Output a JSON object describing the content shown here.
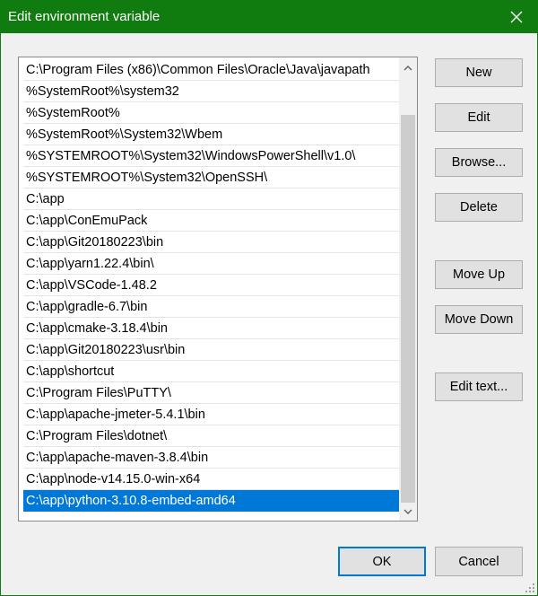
{
  "window": {
    "title": "Edit environment variable"
  },
  "path_list": {
    "selected_index": 20,
    "items": [
      "C:\\Program Files (x86)\\Common Files\\Oracle\\Java\\javapath",
      "%SystemRoot%\\system32",
      "%SystemRoot%",
      "%SystemRoot%\\System32\\Wbem",
      "%SYSTEMROOT%\\System32\\WindowsPowerShell\\v1.0\\",
      "%SYSTEMROOT%\\System32\\OpenSSH\\",
      "C:\\app",
      "C:\\app\\ConEmuPack",
      "C:\\app\\Git20180223\\bin",
      "C:\\app\\yarn1.22.4\\bin\\",
      "C:\\app\\VSCode-1.48.2",
      "C:\\app\\gradle-6.7\\bin",
      "C:\\app\\cmake-3.18.4\\bin",
      "C:\\app\\Git20180223\\usr\\bin",
      "C:\\app\\shortcut",
      "C:\\Program Files\\PuTTY\\",
      "C:\\app\\apache-jmeter-5.4.1\\bin",
      "C:\\Program Files\\dotnet\\",
      "C:\\app\\apache-maven-3.8.4\\bin",
      "C:\\app\\node-v14.15.0-win-x64",
      "C:\\app\\python-3.10.8-embed-amd64"
    ]
  },
  "buttons": {
    "new": "New",
    "edit": "Edit",
    "browse": "Browse...",
    "delete": "Delete",
    "move_up": "Move Up",
    "move_down": "Move Down",
    "edit_text": "Edit text...",
    "ok": "OK",
    "cancel": "Cancel"
  },
  "colors": {
    "titlebar": "#107c10",
    "selection": "#0078d7"
  }
}
